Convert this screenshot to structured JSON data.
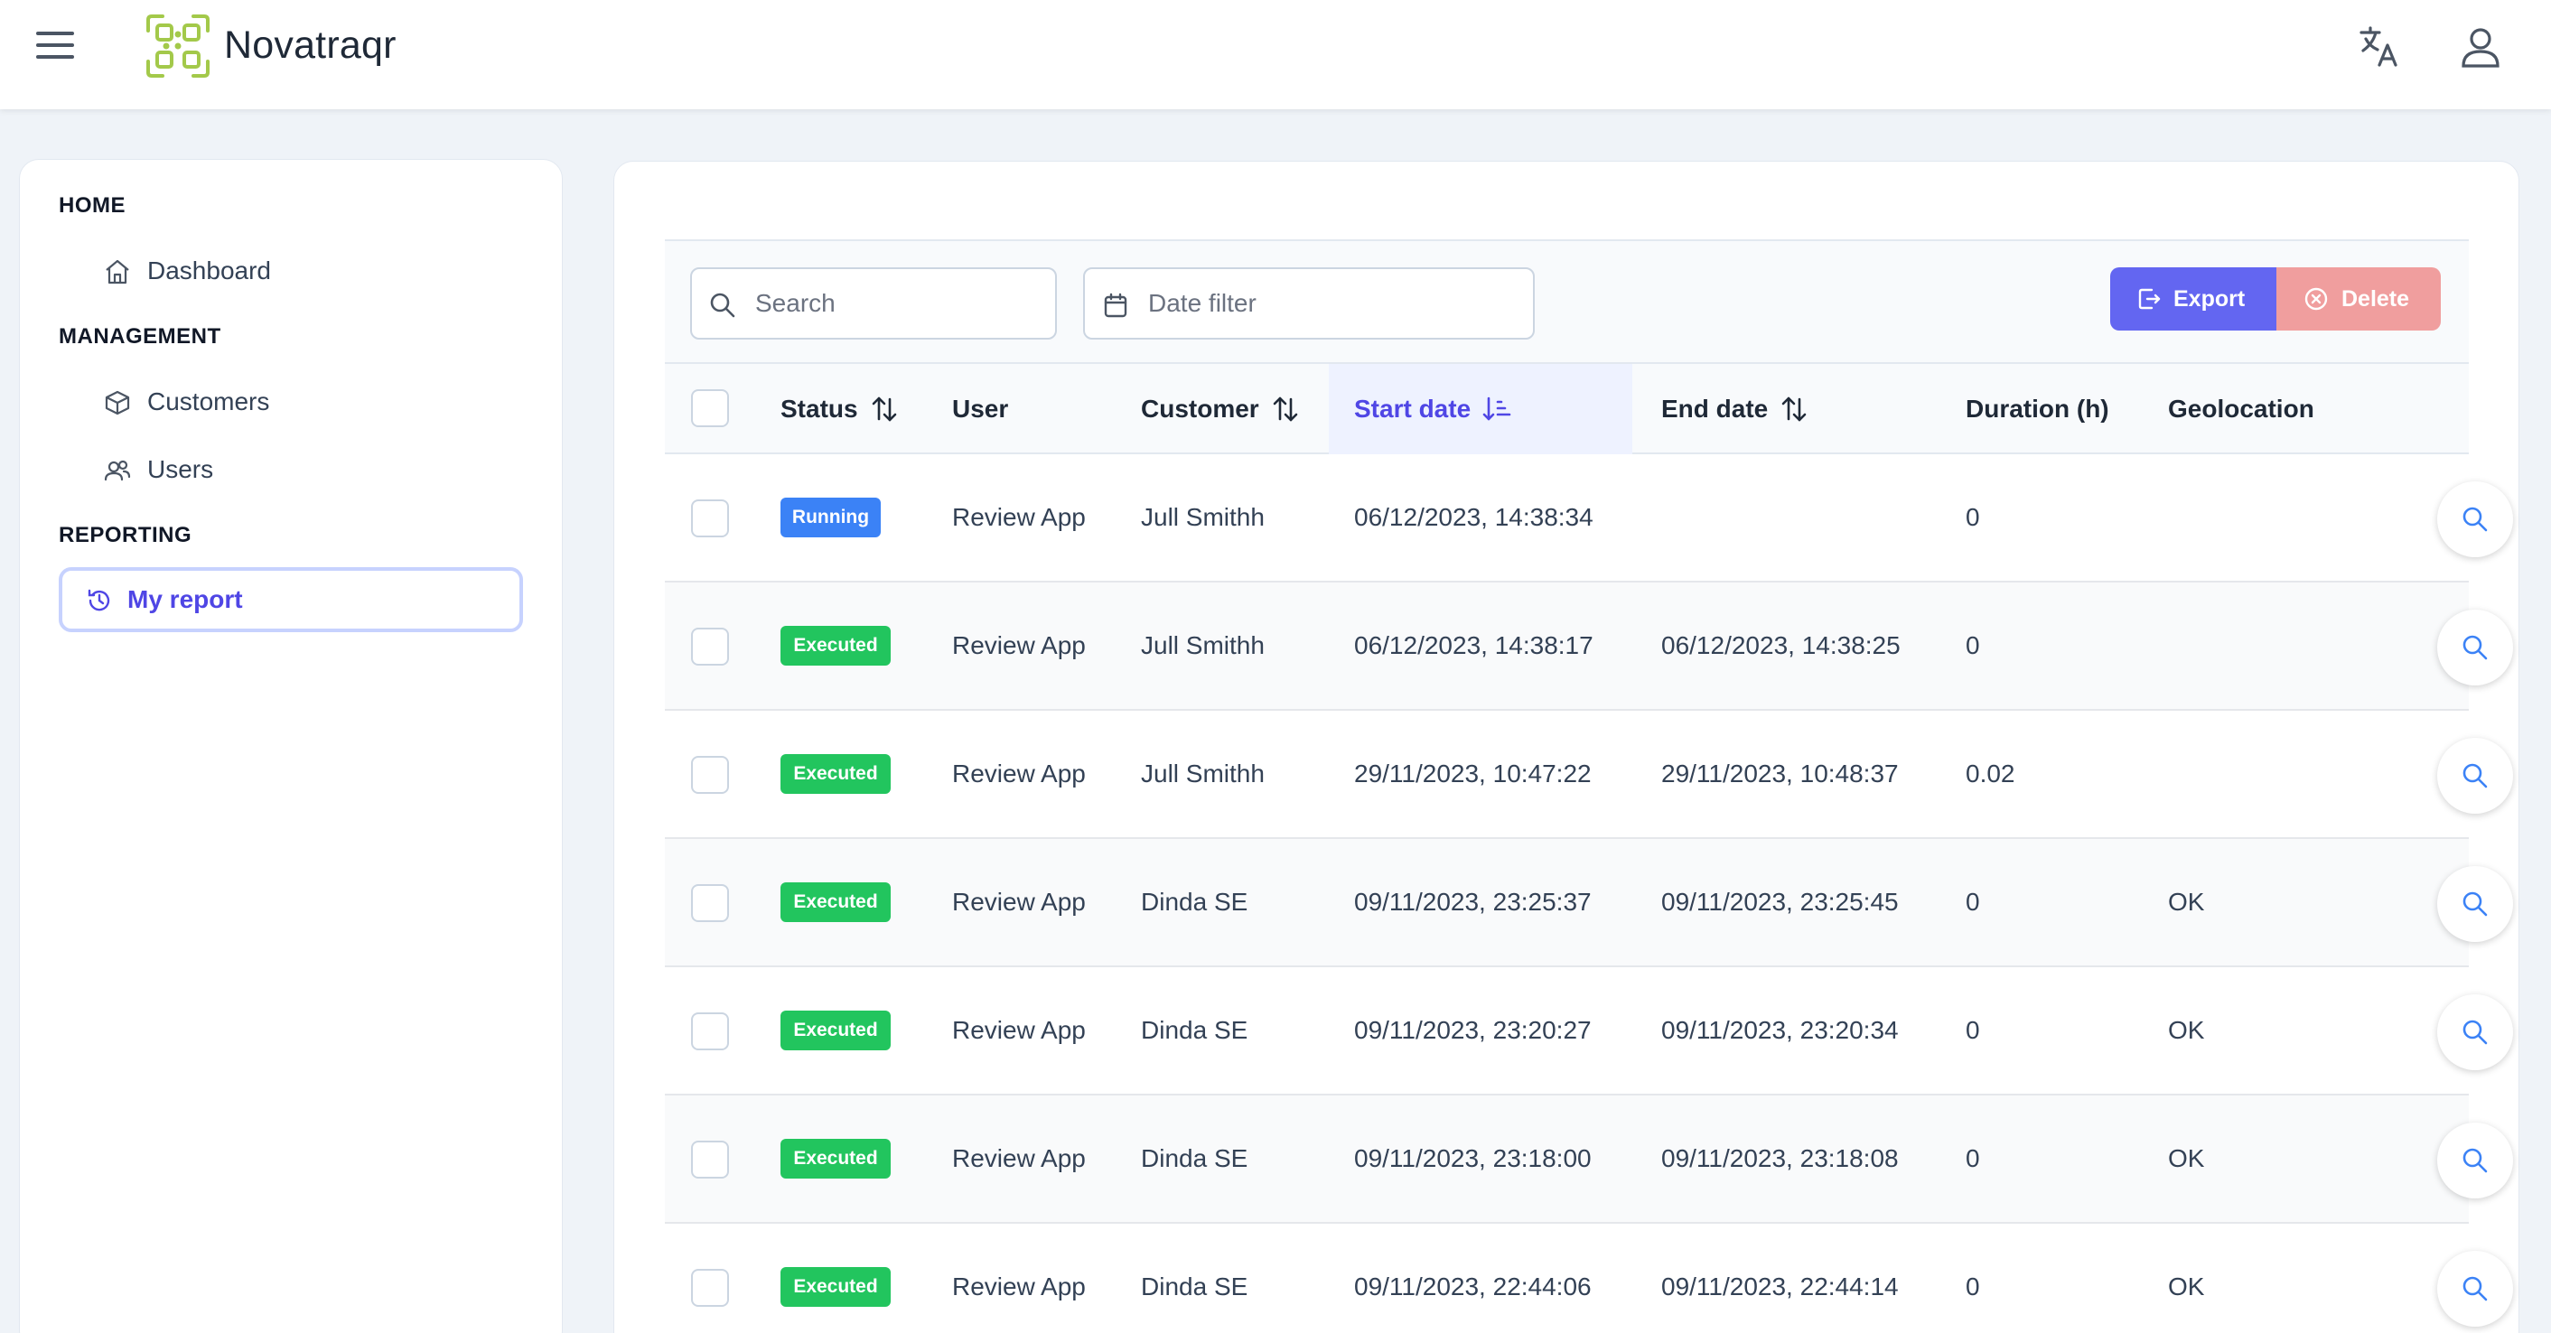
{
  "app": {
    "brand": "Novatraqr"
  },
  "sidebar": {
    "sections": [
      {
        "title": "HOME",
        "items": [
          {
            "label": "Dashboard",
            "icon": "home-icon"
          }
        ]
      },
      {
        "title": "MANAGEMENT",
        "items": [
          {
            "label": "Customers",
            "icon": "box-icon"
          },
          {
            "label": "Users",
            "icon": "users-icon"
          }
        ]
      },
      {
        "title": "REPORTING",
        "items": [
          {
            "label": "My report",
            "icon": "history-icon",
            "active": true
          }
        ]
      }
    ]
  },
  "toolbar": {
    "search_placeholder": "Search",
    "date_placeholder": "Date filter",
    "export_label": "Export",
    "delete_label": "Delete"
  },
  "table": {
    "columns": [
      "Status",
      "User",
      "Customer",
      "Start date",
      "End date",
      "Duration (h)",
      "Geolocation"
    ],
    "rows": [
      {
        "status": "Running",
        "user": "Review App",
        "customer": "Jull Smithh",
        "start": "06/12/2023, 14:38:34",
        "end": "",
        "duration": "0",
        "geo": ""
      },
      {
        "status": "Executed",
        "user": "Review App",
        "customer": "Jull Smithh",
        "start": "06/12/2023, 14:38:17",
        "end": "06/12/2023, 14:38:25",
        "duration": "0",
        "geo": ""
      },
      {
        "status": "Executed",
        "user": "Review App",
        "customer": "Jull Smithh",
        "start": "29/11/2023, 10:47:22",
        "end": "29/11/2023, 10:48:37",
        "duration": "0.02",
        "geo": ""
      },
      {
        "status": "Executed",
        "user": "Review App",
        "customer": "Dinda SE",
        "start": "09/11/2023, 23:25:37",
        "end": "09/11/2023, 23:25:45",
        "duration": "0",
        "geo": "OK"
      },
      {
        "status": "Executed",
        "user": "Review App",
        "customer": "Dinda SE",
        "start": "09/11/2023, 23:20:27",
        "end": "09/11/2023, 23:20:34",
        "duration": "0",
        "geo": "OK"
      },
      {
        "status": "Executed",
        "user": "Review App",
        "customer": "Dinda SE",
        "start": "09/11/2023, 23:18:00",
        "end": "09/11/2023, 23:18:08",
        "duration": "0",
        "geo": "OK"
      },
      {
        "status": "Executed",
        "user": "Review App",
        "customer": "Dinda SE",
        "start": "09/11/2023, 22:44:06",
        "end": "09/11/2023, 22:44:14",
        "duration": "0",
        "geo": "OK"
      }
    ]
  },
  "colors": {
    "accent": "#6366f1",
    "running": "#3b82f6",
    "executed": "#22c55e",
    "delete": "#f09e9e",
    "logo": "#a3c94a"
  }
}
